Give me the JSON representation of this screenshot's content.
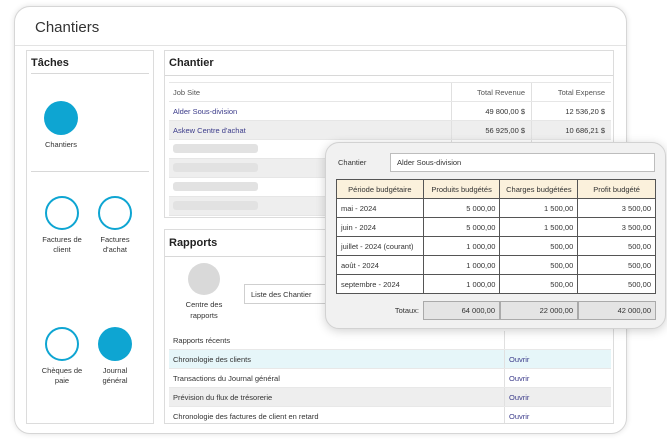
{
  "window": {
    "title": "Chantiers"
  },
  "taches": {
    "title": "Tâches",
    "items": [
      {
        "label": "Chantiers",
        "icon": "chantiers-icon",
        "filled": true
      },
      {
        "label": "Factures de client",
        "icon": "factures-client-icon",
        "filled": false
      },
      {
        "label": "Factures d'achat",
        "icon": "factures-achat-icon",
        "filled": false
      },
      {
        "label": "Chèques de paie",
        "icon": "cheques-paie-icon",
        "filled": false
      },
      {
        "label": "Journal général",
        "icon": "journal-general-icon",
        "filled": true
      }
    ]
  },
  "chantier": {
    "title": "Chantier",
    "columns": [
      "Job Site",
      "Total Revenue",
      "Total Expense"
    ],
    "rows": [
      {
        "site": "Alder Sous-division",
        "revenue": "49 800,00 $",
        "expense": "12 536,20 $"
      },
      {
        "site": "Askew Centre d'achat",
        "revenue": "56 925,00 $",
        "expense": "10 686,21 $"
      }
    ]
  },
  "rapports": {
    "title": "Rapports",
    "centre_label": "Centre des rapports",
    "liste_label": "Liste des Chantier",
    "rows": [
      {
        "name": "Rapports récents",
        "action": ""
      },
      {
        "name": "Chronologie des clients",
        "action": "Ouvrir"
      },
      {
        "name": "Transactions du Journal général",
        "action": "Ouvrir"
      },
      {
        "name": "Prévision du flux de trésorerie",
        "action": "Ouvrir"
      },
      {
        "name": "Chronologie des factures de client en retard",
        "action": "Ouvrir"
      }
    ]
  },
  "card": {
    "label": "Chantier",
    "value": "Alder Sous-division",
    "columns": [
      "Période budgétaire",
      "Produits budgétés",
      "Charges budgétées",
      "Profit budgété"
    ],
    "rows": [
      {
        "period": "mai - 2024",
        "produits": "5 000,00",
        "charges": "1 500,00",
        "profit": "3 500,00"
      },
      {
        "period": "juin - 2024",
        "produits": "5 000,00",
        "charges": "1 500,00",
        "profit": "3 500,00"
      },
      {
        "period": "juillet - 2024 (courant)",
        "produits": "1 000,00",
        "charges": "500,00",
        "profit": "500,00"
      },
      {
        "period": "août - 2024",
        "produits": "1 000,00",
        "charges": "500,00",
        "profit": "500,00"
      },
      {
        "period": "septembre - 2024",
        "produits": "1 000,00",
        "charges": "500,00",
        "profit": "500,00"
      }
    ],
    "totals_label": "Totaux:",
    "totals": {
      "produits": "64 000,00",
      "charges": "22 000,00",
      "profit": "42 000,00"
    }
  },
  "colors": {
    "accent": "#0ea5d2",
    "highlight_row": "#e6f6f9",
    "table_header": "#fbf1dc",
    "link": "#3b3b8a"
  }
}
